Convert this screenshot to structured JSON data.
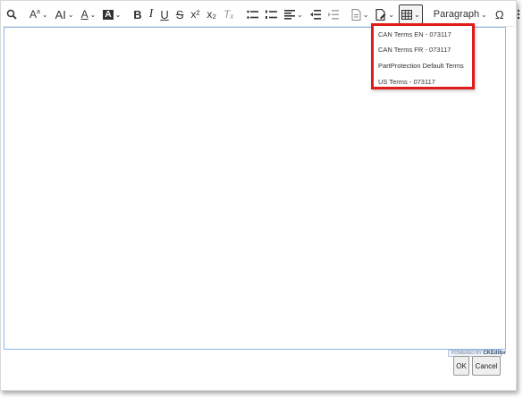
{
  "toolbar": {
    "find_icon": "magnifier-icon",
    "superscript_label": "x²",
    "subscript_label": "x₂",
    "clear_format_label": "Tₓ",
    "paragraph_label": "Paragraph",
    "special_chars_label": "Ω"
  },
  "dropdown": {
    "items": [
      {
        "label": "CAN Terms EN - 073117"
      },
      {
        "label": "CAN Terms FR - 073117"
      },
      {
        "label": "PartProtection Default Terms"
      },
      {
        "label": "US Terms - 073117"
      }
    ],
    "highlight_color": "#e01b1b"
  },
  "editor": {
    "powered_prefix": "POWERED BY",
    "powered_brand": "CKEditor"
  },
  "footer": {
    "ok_label": "OK",
    "cancel_label": "Cancel"
  }
}
